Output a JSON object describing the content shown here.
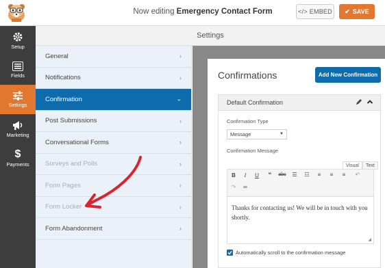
{
  "header": {
    "editing_prefix": "Now editing",
    "form_name": "Emergency Contact Form",
    "embed_label": "EMBED",
    "save_label": "SAVE"
  },
  "leftnav": [
    {
      "label": "Setup",
      "icon": "gear-icon",
      "active": false
    },
    {
      "label": "Fields",
      "icon": "list-icon",
      "active": false
    },
    {
      "label": "Settings",
      "icon": "sliders-icon",
      "active": true
    },
    {
      "label": "Marketing",
      "icon": "megaphone-icon",
      "active": false
    },
    {
      "label": "Payments",
      "icon": "dollar-icon",
      "active": false
    }
  ],
  "settings_title": "Settings",
  "menu": [
    {
      "label": "General",
      "state": "normal"
    },
    {
      "label": "Notifications",
      "state": "normal"
    },
    {
      "label": "Confirmation",
      "state": "active"
    },
    {
      "label": "Post Submissions",
      "state": "normal"
    },
    {
      "label": "Conversational Forms",
      "state": "normal"
    },
    {
      "label": "Surveys and Polls",
      "state": "dim"
    },
    {
      "label": "Form Pages",
      "state": "dim"
    },
    {
      "label": "Form Locker",
      "state": "dim"
    },
    {
      "label": "Form Abandonment",
      "state": "normal"
    }
  ],
  "confirmations": {
    "title": "Confirmations",
    "add_button": "Add New Confirmation",
    "box_title": "Default Confirmation",
    "type_label": "Confirmation Type",
    "type_value": "Message",
    "message_label": "Confirmation Message",
    "tab_visual": "Visual",
    "tab_text": "Text",
    "message_text": "Thanks for contacting us! We will be in touch with you shortly.",
    "scroll_label": "Automatically scroll to the confirmation message",
    "scroll_checked": true
  },
  "colors": {
    "accent": "#e27730",
    "primary": "#0e6cad",
    "nav_bg": "#3d3d3d",
    "annotation_arrow": "#d9232d"
  }
}
